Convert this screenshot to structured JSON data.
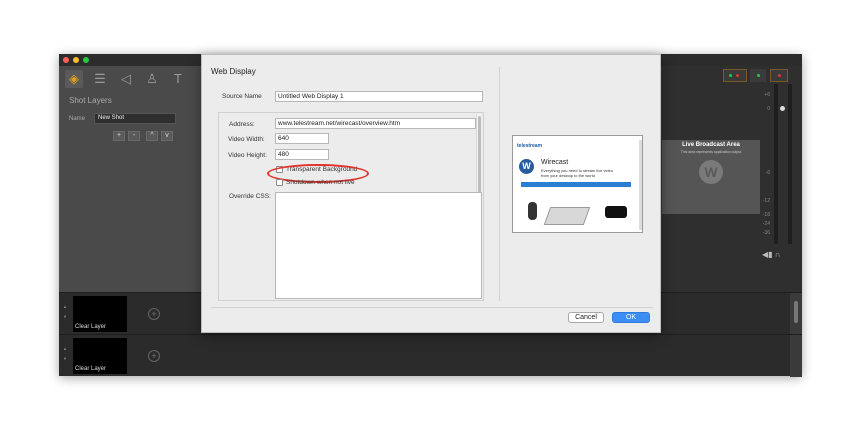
{
  "dialog": {
    "title": "Web Display",
    "source_name_label": "Source Name",
    "source_name_value": "Untitled Web Display 1",
    "address_label": "Address:",
    "address_value": "www.telestream.net/wirecast/overview.htm",
    "video_width_label": "Video Width:",
    "video_width_value": "640",
    "video_height_label": "Video Height:",
    "video_height_value": "480",
    "transparent_label": "Transparent Background",
    "shutdown_label": "Shutdown when not live",
    "override_css_label": "Override CSS:",
    "cancel_label": "Cancel",
    "ok_label": "OK",
    "highlight_color": "#e0342c",
    "ok_color": "#3c8ef5"
  },
  "web_preview": {
    "logo": "telestream",
    "title": "Wirecast",
    "subtitle": "Everything you need to stream live video from your desktop to the world"
  },
  "left_panel": {
    "heading": "Shot Layers",
    "name_label": "Name",
    "name_value": "New Shot",
    "tools": [
      "layers-icon",
      "list-icon",
      "audio-icon",
      "user-icon",
      "text-icon"
    ],
    "buttons": [
      "+",
      "-",
      "^",
      "v"
    ]
  },
  "right_panel": {
    "live_title": "Live Broadcast Area",
    "live_subtitle": "This area represents application output",
    "meter_labels": [
      "+6",
      "0",
      "-6",
      "-12",
      "-18",
      "-24",
      "-36"
    ]
  },
  "layers": [
    {
      "label": "Clear Layer"
    },
    {
      "label": "Clear Layer"
    }
  ],
  "colors": {
    "traffic_red": "#fc5f57",
    "traffic_yellow": "#fdbc2e",
    "traffic_green": "#28c840"
  }
}
